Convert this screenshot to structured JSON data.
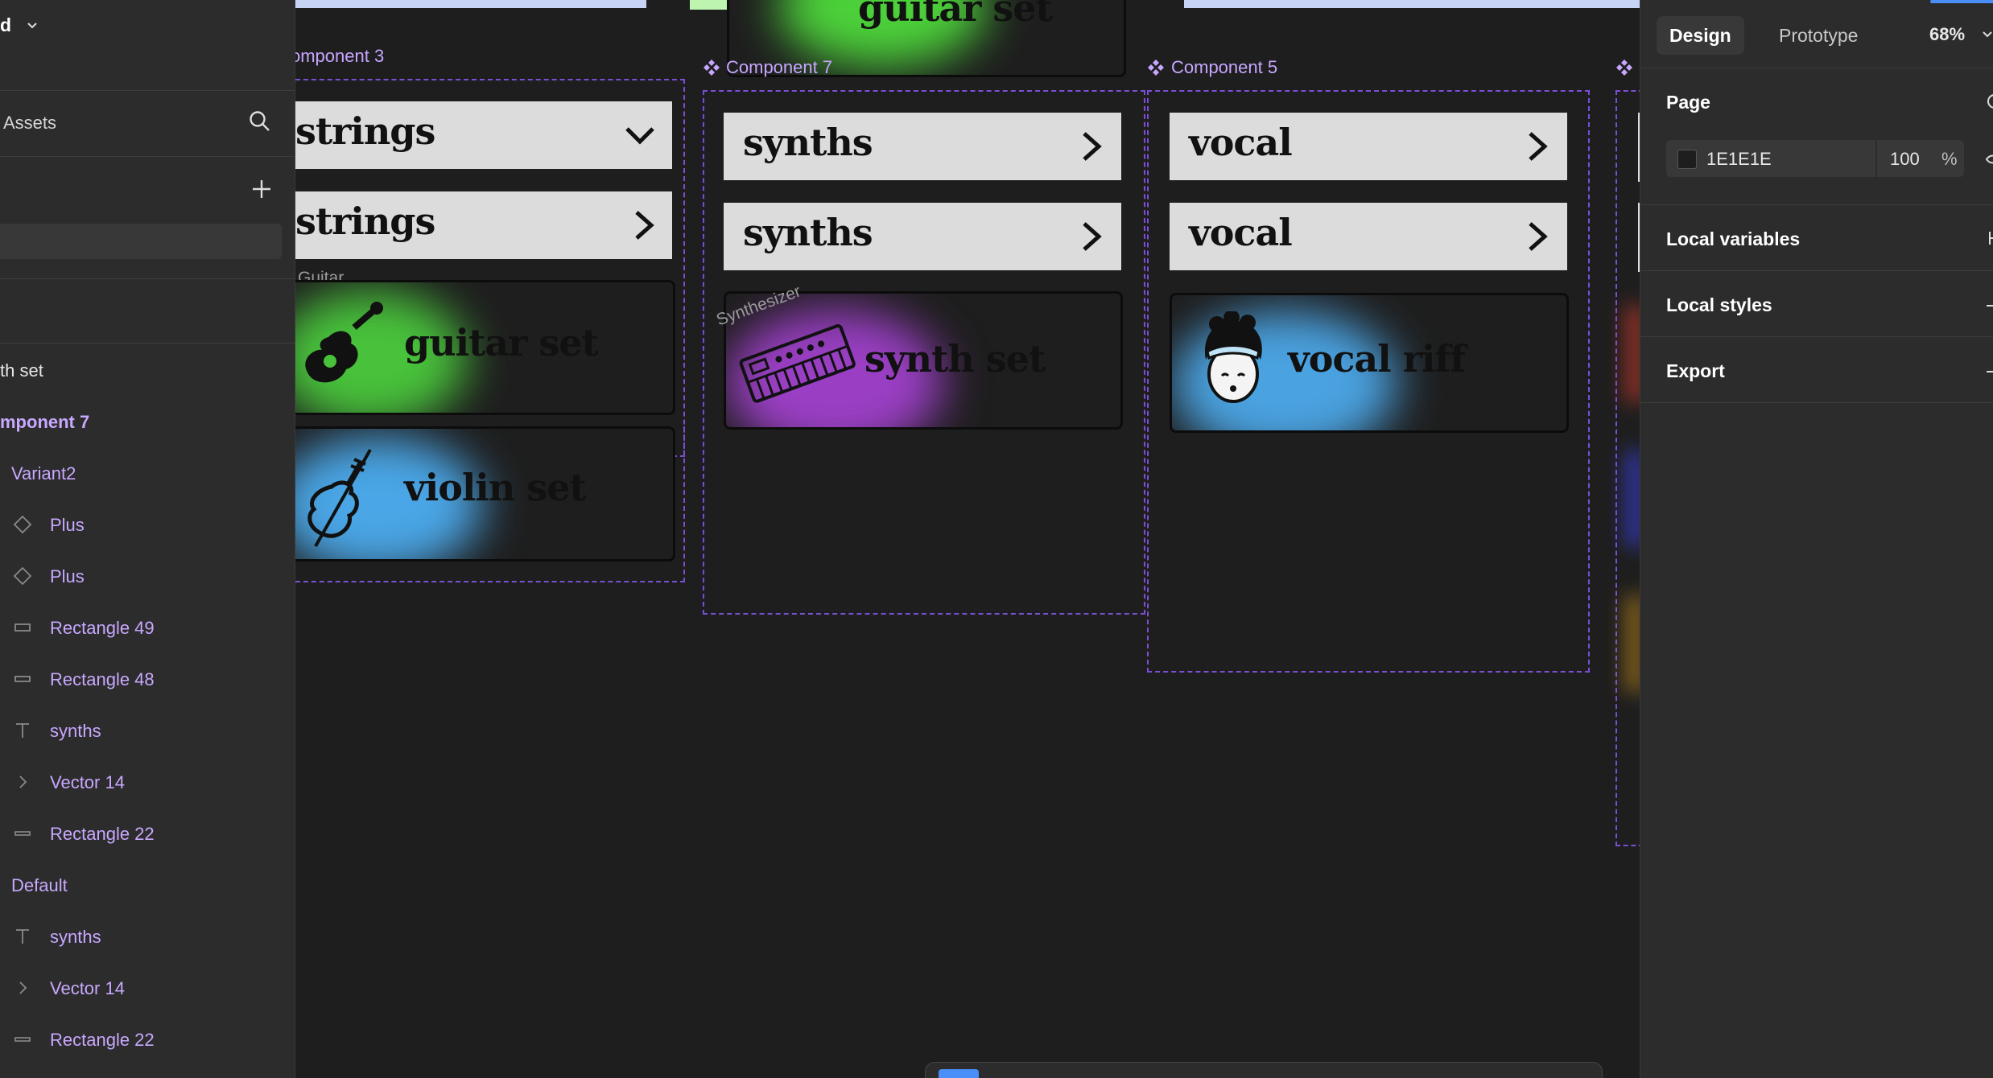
{
  "sidebar": {
    "file_name_fragment": "d",
    "assets_tab": "Assets",
    "layers": [
      {
        "label": "th set",
        "type": "text",
        "style": "plain"
      },
      {
        "label": "mponent 7",
        "type": "component",
        "style": "purple-bold"
      },
      {
        "label": "Variant2",
        "type": "variant",
        "style": "purple"
      },
      {
        "label": "Plus",
        "type": "diamond"
      },
      {
        "label": "Plus",
        "type": "diamond"
      },
      {
        "label": "Rectangle 49",
        "type": "rect"
      },
      {
        "label": "Rectangle 48",
        "type": "rect"
      },
      {
        "label": "synths",
        "type": "text-layer"
      },
      {
        "label": "Vector 14",
        "type": "vector"
      },
      {
        "label": "Rectangle 22",
        "type": "line"
      },
      {
        "label": "Default",
        "type": "variant",
        "style": "purple"
      },
      {
        "label": "synths",
        "type": "text-layer"
      },
      {
        "label": "Vector 14",
        "type": "vector"
      },
      {
        "label": "Rectangle 22",
        "type": "line"
      }
    ]
  },
  "canvas": {
    "top_card_text": "guitar set",
    "components": [
      {
        "label": "omponent 3",
        "pills": [
          {
            "text": "strings",
            "arrow": "down"
          },
          {
            "text": "strings",
            "arrow": "right"
          }
        ],
        "caption": "Guitar",
        "cards": [
          {
            "text": "guitar set",
            "glow": "#48c23b",
            "icon": "guitar-icon"
          },
          {
            "text": "violin set",
            "glow": "#4aa6e6",
            "icon": "violin-icon"
          }
        ]
      },
      {
        "label": "Component 7",
        "pills": [
          {
            "text": "synths",
            "arrow": "right"
          },
          {
            "text": "synths",
            "arrow": "right"
          }
        ],
        "caption": "Synthesizer",
        "cards": [
          {
            "text": "synth set",
            "glow": "#9a3fc4",
            "icon": "synthesizer-icon"
          }
        ]
      },
      {
        "label": "Component 5",
        "pills": [
          {
            "text": "vocal",
            "arrow": "right"
          },
          {
            "text": "vocal",
            "arrow": "right"
          }
        ],
        "cards": [
          {
            "text": "vocal riff",
            "glow": "#4aa2e0",
            "icon": "singer-face-icon"
          }
        ]
      }
    ]
  },
  "right_panel": {
    "tabs": [
      "Design",
      "Prototype"
    ],
    "active_tab": "Design",
    "zoom": "68%",
    "sections": {
      "page": "Page",
      "local_variables": "Local variables",
      "local_styles": "Local styles",
      "export": "Export"
    },
    "page_color": {
      "hex": "1E1E1E",
      "opacity": "100",
      "unit": "%"
    }
  },
  "colors": {
    "accent_purple": "#c7a6ff",
    "frame_dash": "#7a4fd6",
    "accent_blue": "#4a8ff7"
  }
}
